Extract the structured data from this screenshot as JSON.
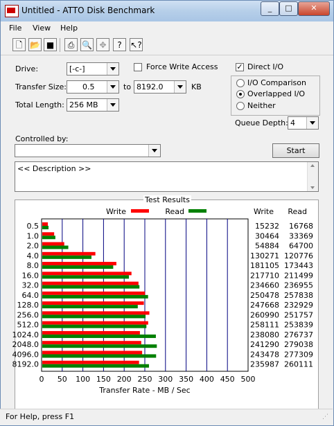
{
  "window": {
    "title": "Untitled - ATTO Disk Benchmark",
    "caption_buttons": [
      "minimize",
      "maximize",
      "close"
    ]
  },
  "menu": [
    "File",
    "View",
    "Help"
  ],
  "toolbar": {
    "icons": [
      "new-icon",
      "open-icon",
      "save-icon",
      "print-icon",
      "print-preview-icon",
      "move-icon",
      "help-icon",
      "context-help-icon"
    ]
  },
  "form": {
    "drive_label": "Drive:",
    "drive_value": "[-c-]",
    "force_write_label": "Force Write Access",
    "force_write_checked": false,
    "direct_io_label": "Direct I/O",
    "direct_io_checked": true,
    "transfer_size_label": "Transfer Size:",
    "transfer_from": "0.5",
    "to_label": "to",
    "transfer_to": "8192.0",
    "kb_label": "KB",
    "total_length_label": "Total Length:",
    "total_length_value": "256 MB",
    "io_options": [
      "I/O Comparison",
      "Overlapped I/O",
      "Neither"
    ],
    "io_selected": "Overlapped I/O",
    "queue_depth_label": "Queue Depth:",
    "queue_depth_value": "4",
    "controlled_by_label": "Controlled by:",
    "controlled_by_value": "",
    "start_label": "Start",
    "description": "<< Description >>"
  },
  "chart_data": {
    "type": "bar",
    "title": "Test Results",
    "xlabel": "Transfer Rate - MB / Sec",
    "xlim": [
      0,
      500
    ],
    "xticks": [
      "0",
      "50",
      "100",
      "150",
      "200",
      "250",
      "300",
      "350",
      "400",
      "450",
      "500"
    ],
    "categories": [
      "0.5",
      "1.0",
      "2.0",
      "4.0",
      "8.0",
      "16.0",
      "32.0",
      "64.0",
      "128.0",
      "256.0",
      "512.0",
      "1024.0",
      "2048.0",
      "4096.0",
      "8192.0"
    ],
    "series": [
      {
        "name": "Write",
        "color": "#ff0000",
        "values": [
          15.232,
          30.464,
          54.884,
          130.271,
          181.105,
          217.71,
          234.66,
          250.478,
          247.668,
          260.99,
          258.111,
          238.08,
          241.29,
          243.478,
          235.987
        ]
      },
      {
        "name": "Read",
        "color": "#008000",
        "values": [
          16.768,
          33.369,
          64.7,
          120.776,
          173.443,
          211.499,
          236.955,
          257.838,
          232.929,
          251.757,
          253.839,
          276.737,
          279.038,
          277.309,
          260.111
        ]
      }
    ],
    "table_headers": [
      "Write",
      "Read"
    ],
    "table_rows": [
      [
        "15232",
        "16768"
      ],
      [
        "30464",
        "33369"
      ],
      [
        "54884",
        "64700"
      ],
      [
        "130271",
        "120776"
      ],
      [
        "181105",
        "173443"
      ],
      [
        "217710",
        "211499"
      ],
      [
        "234660",
        "236955"
      ],
      [
        "250478",
        "257838"
      ],
      [
        "247668",
        "232929"
      ],
      [
        "260990",
        "251757"
      ],
      [
        "258111",
        "253839"
      ],
      [
        "238080",
        "276737"
      ],
      [
        "241290",
        "279038"
      ],
      [
        "243478",
        "277309"
      ],
      [
        "235987",
        "260111"
      ]
    ],
    "grid": true,
    "legend_position": "top"
  },
  "status": {
    "text": "For Help, press F1"
  }
}
